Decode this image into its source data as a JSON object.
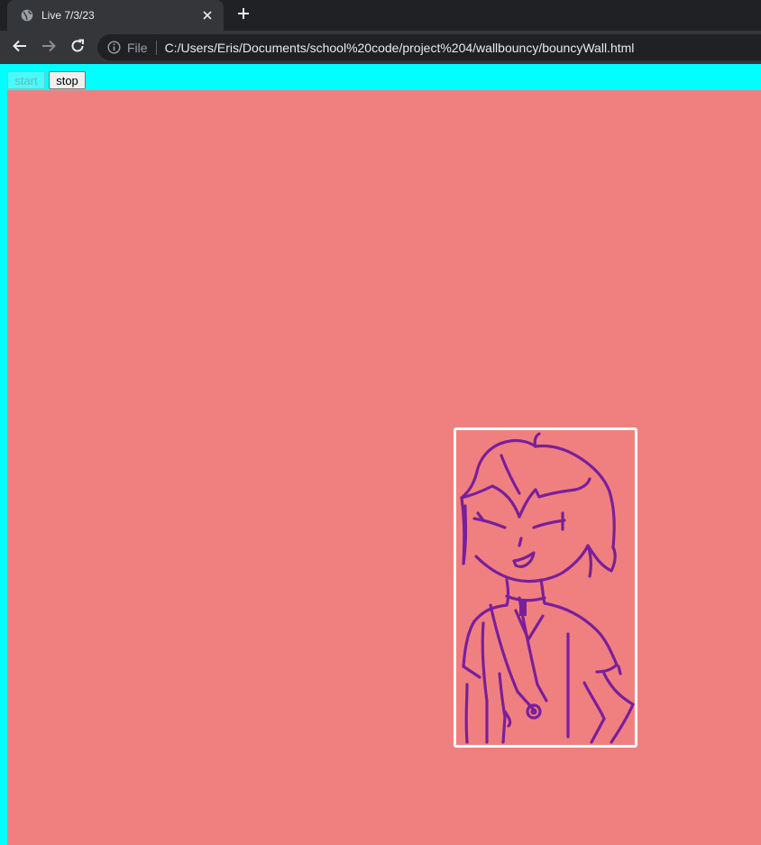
{
  "browser": {
    "tab": {
      "title": "Live 7/3/23",
      "favicon": "globe-icon"
    },
    "toolbar": {
      "scheme_label": "File",
      "url": "C:/Users/Eris/Documents/school%20code/project%204/wallbouncy/bouncyWall.html"
    }
  },
  "page": {
    "background_color": "#00ffff",
    "wall_color": "#f08080",
    "buttons": {
      "start_label": "start",
      "stop_label": "stop",
      "start_disabled": true
    },
    "bouncer": {
      "border_color": "#ffffff",
      "line_color": "#7a1f9a",
      "image": "drawn-character-image"
    }
  }
}
